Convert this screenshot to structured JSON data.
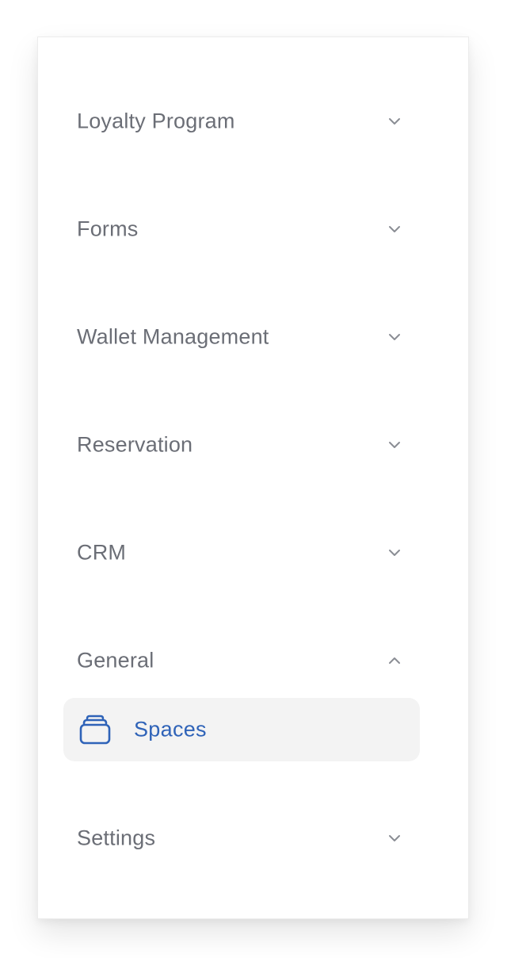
{
  "colors": {
    "text": "#6b6e76",
    "chevron": "#8a8d94",
    "active_text": "#2f63b8",
    "active_bg": "#f3f3f3"
  },
  "menu": {
    "sections": [
      {
        "label": "Loyalty Program",
        "expanded": false,
        "icon": "chevron-down-icon"
      },
      {
        "label": "Forms",
        "expanded": false,
        "icon": "chevron-down-icon"
      },
      {
        "label": "Wallet Management",
        "expanded": false,
        "icon": "chevron-down-icon"
      },
      {
        "label": "Reservation",
        "expanded": false,
        "icon": "chevron-down-icon"
      },
      {
        "label": "CRM",
        "expanded": false,
        "icon": "chevron-down-icon"
      },
      {
        "label": "General",
        "expanded": true,
        "icon": "chevron-up-icon"
      },
      {
        "label": "Settings",
        "expanded": false,
        "icon": "chevron-down-icon"
      }
    ],
    "general_items": [
      {
        "label": "Spaces",
        "icon": "stack-icon",
        "active": true
      }
    ]
  }
}
